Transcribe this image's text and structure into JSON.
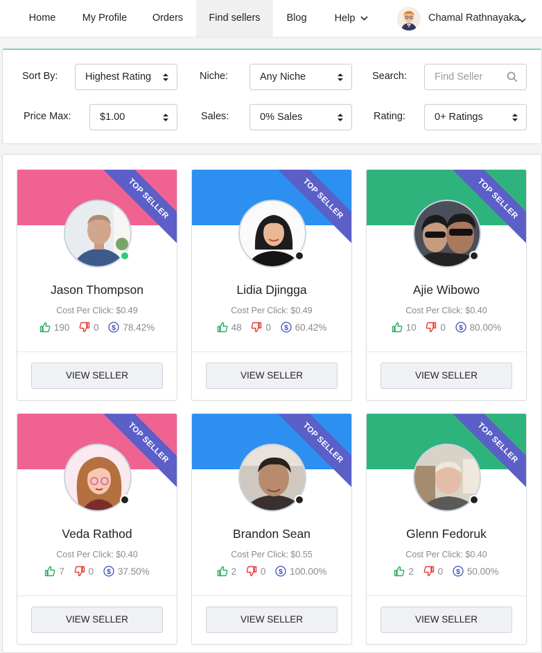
{
  "nav": {
    "items": [
      {
        "label": "Home"
      },
      {
        "label": "My Profile"
      },
      {
        "label": "Orders"
      },
      {
        "label": "Find sellers"
      },
      {
        "label": "Blog"
      },
      {
        "label": "Help"
      }
    ],
    "user_name": "Chamal Rathnayaka"
  },
  "filters": {
    "sort_label": "Sort By:",
    "sort_value": "Highest Rating",
    "niche_label": "Niche:",
    "niche_value": "Any Niche",
    "search_label": "Search:",
    "search_placeholder": "Find Seller",
    "price_label": "Price Max:",
    "price_value": "$1.00",
    "sales_label": "Sales:",
    "sales_value": "0% Sales",
    "rating_label": "Rating:",
    "rating_value": "0+ Ratings"
  },
  "colors": {
    "pink": "#f06292",
    "blue": "#2d8ff0",
    "green": "#2fb37c",
    "ribbon": "#5b5fc7",
    "like": "#27ae60",
    "dislike": "#e53935",
    "dollar": "#3f51b5"
  },
  "sellers": [
    {
      "name": "Jason Thompson",
      "cpc": "Cost Per Click: $0.49",
      "likes": "190",
      "dislikes": "0",
      "rate": "78.42%",
      "badge": "TOP SELLER",
      "button": "VIEW SELLER",
      "theme": "pink",
      "status": "online"
    },
    {
      "name": "Lidia Djingga",
      "cpc": "Cost Per Click: $0.49",
      "likes": "48",
      "dislikes": "0",
      "rate": "60.42%",
      "badge": "TOP SELLER",
      "button": "VIEW SELLER",
      "theme": "blue",
      "status": "offline"
    },
    {
      "name": "Ajie Wibowo",
      "cpc": "Cost Per Click: $0.40",
      "likes": "10",
      "dislikes": "0",
      "rate": "80.00%",
      "badge": "TOP SELLER",
      "button": "VIEW SELLER",
      "theme": "green",
      "status": "offline"
    },
    {
      "name": "Veda Rathod",
      "cpc": "Cost Per Click: $0.40",
      "likes": "7",
      "dislikes": "0",
      "rate": "37.50%",
      "badge": "TOP SELLER",
      "button": "VIEW SELLER",
      "theme": "pink",
      "status": "offline"
    },
    {
      "name": "Brandon Sean",
      "cpc": "Cost Per Click: $0.55",
      "likes": "2",
      "dislikes": "0",
      "rate": "100.00%",
      "badge": "TOP SELLER",
      "button": "VIEW SELLER",
      "theme": "blue",
      "status": "offline"
    },
    {
      "name": "Glenn Fedoruk",
      "cpc": "Cost Per Click: $0.40",
      "likes": "2",
      "dislikes": "0",
      "rate": "50.00%",
      "badge": "TOP SELLER",
      "button": "VIEW SELLER",
      "theme": "green",
      "status": "offline"
    }
  ]
}
